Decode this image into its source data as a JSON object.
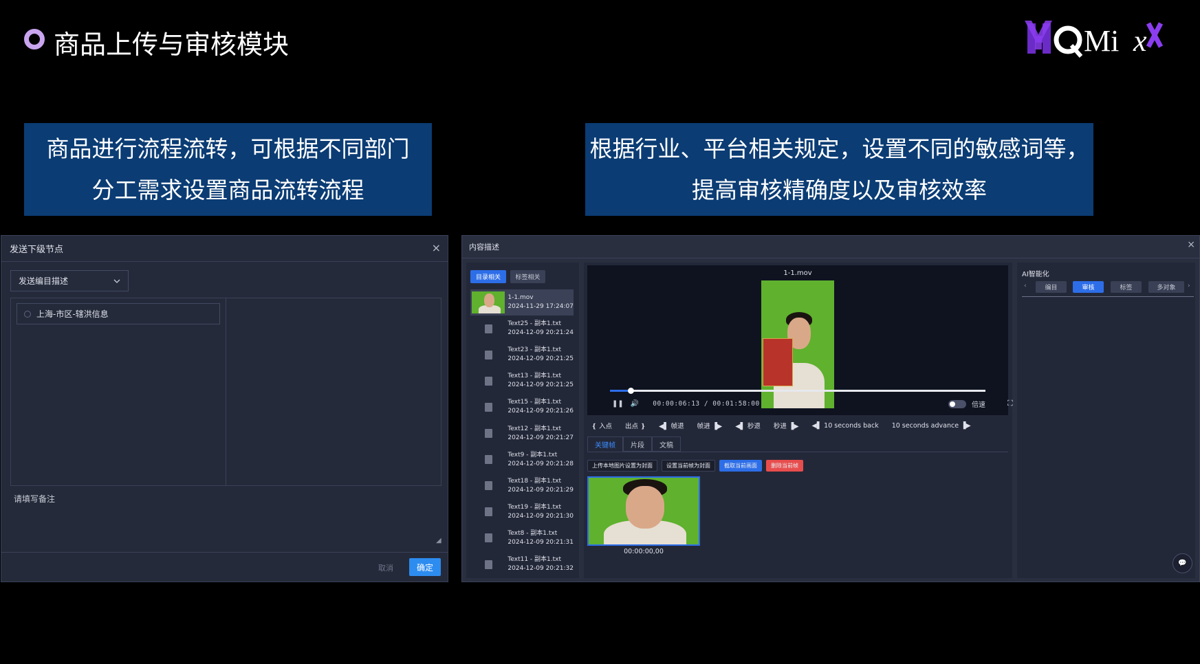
{
  "header": {
    "title": "商品上传与审核模块",
    "logo_text": "YHQMiX"
  },
  "banners": {
    "left": [
      "商品进行流程流转，可根据不同部门",
      "分工需求设置商品流转流程"
    ],
    "right": [
      "根据行业、平台相关规定，设置不同的敏感词等，",
      "提高审核精确度以及审核效率"
    ]
  },
  "left_dialog": {
    "title": "发送下级节点",
    "close_icon": "×",
    "select_value": "发送编目描述",
    "tree_node": "上海-市区-辖洪信息",
    "remark_placeholder": "请填写备注",
    "cancel_label": "取消",
    "ok_label": "确定"
  },
  "right_dialog": {
    "title": "内容描述",
    "close_icon": "×",
    "list_tabs": [
      "目录相关",
      "标签相关"
    ],
    "files": [
      {
        "name": "1-1.mov",
        "date": "2024-11-29 17:24:07",
        "type": "video"
      },
      {
        "name": "Text25 - 副本1.txt",
        "date": "2024-12-09 20:21:24",
        "type": "txt"
      },
      {
        "name": "Text23 - 副本1.txt",
        "date": "2024-12-09 20:21:25",
        "type": "txt"
      },
      {
        "name": "Text13 - 副本1.txt",
        "date": "2024-12-09 20:21:25",
        "type": "txt"
      },
      {
        "name": "Text15 - 副本1.txt",
        "date": "2024-12-09 20:21:26",
        "type": "txt"
      },
      {
        "name": "Text12 - 副本1.txt",
        "date": "2024-12-09 20:21:27",
        "type": "txt"
      },
      {
        "name": "Text9 - 副本1.txt",
        "date": "2024-12-09 20:21:28",
        "type": "txt"
      },
      {
        "name": "Text18 - 副本1.txt",
        "date": "2024-12-09 20:21:29",
        "type": "txt"
      },
      {
        "name": "Text19 - 副本1.txt",
        "date": "2024-12-09 20:21:30",
        "type": "txt"
      },
      {
        "name": "Text8 - 副本1.txt",
        "date": "2024-12-09 20:21:31",
        "type": "txt"
      },
      {
        "name": "Text11 - 副本1.txt",
        "date": "2024-12-09 20:21:32",
        "type": "txt"
      }
    ],
    "player": {
      "video_title": "1-1.mov",
      "time_display": "00:00:06:13 / 00:01:58:00",
      "progress": 0.0554,
      "speed_label": "倍速",
      "steps": [
        "❴ 入点",
        "出点 ❵",
        "◀▌ 帧退",
        "帧进 ▐▶",
        "◀▌ 秒退",
        "秒进 ▐▶",
        "◀▌ 10 seconds back",
        "10 seconds advance ▐▶"
      ],
      "sub_tabs": [
        "关键帧",
        "片段",
        "文稿"
      ],
      "actions": [
        "上传本地图片设置为封面",
        "设置当前帧为封面",
        "截取当前画面",
        "删除当前帧"
      ],
      "keyframe_time": "00:00:00,00"
    },
    "ai": {
      "title": "AI智能化",
      "tabs": [
        "编目",
        "审核",
        "标签",
        "多对象"
      ],
      "active_tab": "审核"
    }
  },
  "colors": {
    "accent": "#2d6ee8",
    "banner_bg": "#0b3c74",
    "danger": "#e84d4d",
    "ok_button": "#2d8cf0"
  }
}
